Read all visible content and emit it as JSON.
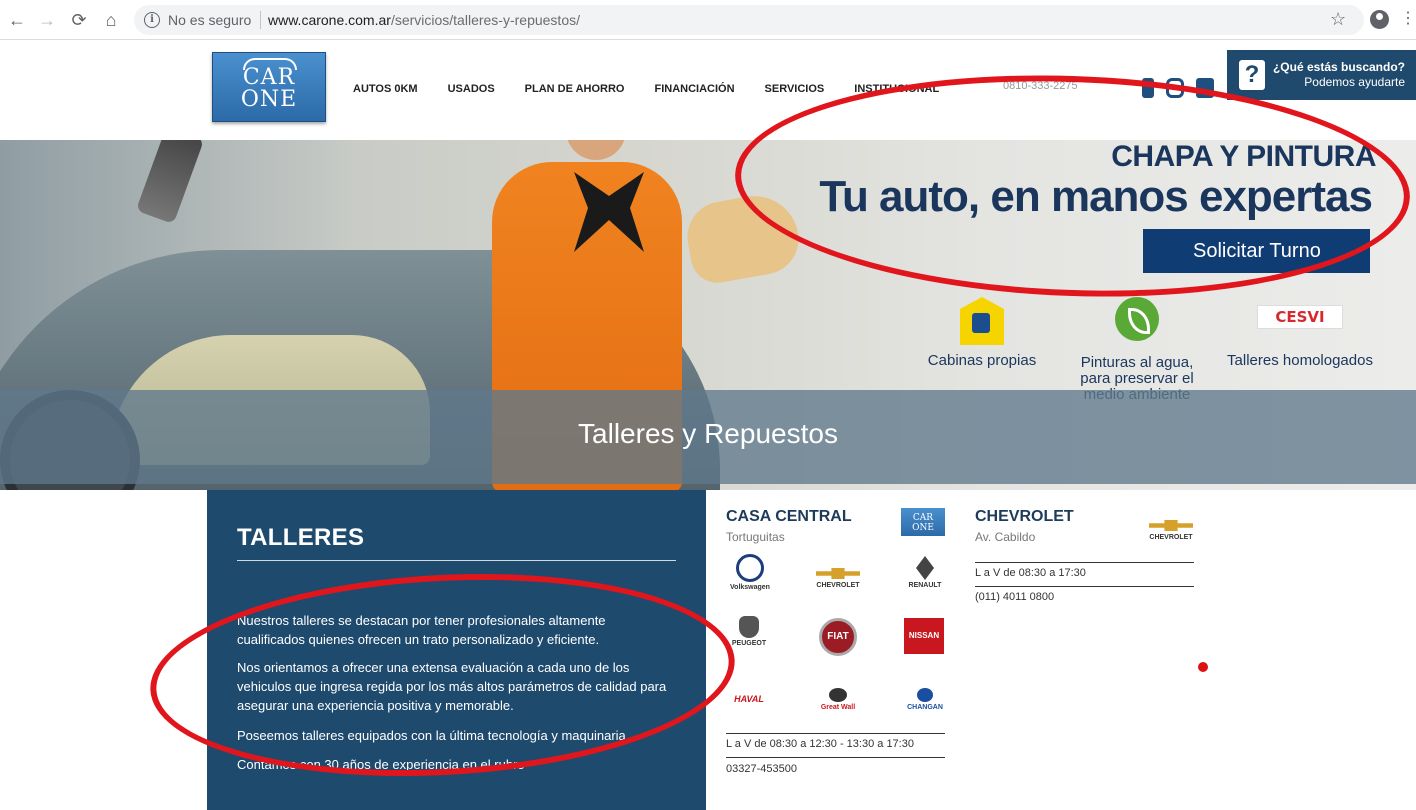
{
  "browser": {
    "back": "←",
    "forward": "→",
    "reload": "⟳",
    "home": "⌂",
    "security_label": "No es seguro",
    "url_host": "www.carone.com.ar",
    "url_path": "/servicios/talleres-y-repuestos/",
    "bookmark_icon": "star-icon",
    "profile_icon": "account-icon"
  },
  "site": {
    "logo_line1": "CAR",
    "logo_line2": "ONE",
    "nav": [
      "AUTOS 0KM",
      "USADOS",
      "PLAN DE AHORRO",
      "FINANCIACIÓN",
      "SERVICIOS",
      "INSTITUCIONAL"
    ],
    "phone": "0810-333-2275",
    "help_title": "¿Qué estás buscando?",
    "help_sub": "Podemos ayudarte",
    "help_icon": "?"
  },
  "hero": {
    "promo_sub": "CHAPA Y PINTURA",
    "promo_title": "Tu auto, en manos expertas",
    "button": "Solicitar Turno",
    "features": [
      {
        "label": "Cabinas propias",
        "icon": "cabin-icon"
      },
      {
        "label": "Pinturas al agua, para preservar el medio ambiente",
        "icon": "leaf-icon"
      },
      {
        "label": "Talleres homologados",
        "icon": "cesvi-logo",
        "logo_text": "CESVI"
      }
    ],
    "page_title": "Talleres y Repuestos"
  },
  "talleres": {
    "title": "TALLERES",
    "p1": "Nuestros talleres se destacan por tener profesionales altamente cualificados quienes ofrecen un trato personalizado y eficiente.",
    "p2": "Nos orientamos a ofrecer una extensa evaluación a cada uno de los vehiculos que ingresa regida por los más altos parámetros de calidad para asegurar una experiencia positiva y memorable.",
    "p3": "Poseemos talleres equipados con la última tecnología y maquinaria.",
    "p4": "Contamos con 30 años de experiencia en el rubro"
  },
  "branches": {
    "central": {
      "title": "CASA CENTRAL",
      "location": "Tortuguitas",
      "hours": "L a V de 08:30 a 12:30 - 13:30 a 17:30",
      "phone": "03327-453500",
      "brands": [
        "Volkswagen",
        "CHEVROLET",
        "RENAULT",
        "PEUGEOT",
        "FIAT",
        "NISSAN",
        "HAVAL",
        "Great Wall",
        "CHANGAN"
      ]
    },
    "chevrolet": {
      "title": "CHEVROLET",
      "location": "Av. Cabildo",
      "hours": "L a V de 08:30 a 17:30",
      "phone": "(011) 4011 0800",
      "brand": "CHEVROLET"
    }
  }
}
